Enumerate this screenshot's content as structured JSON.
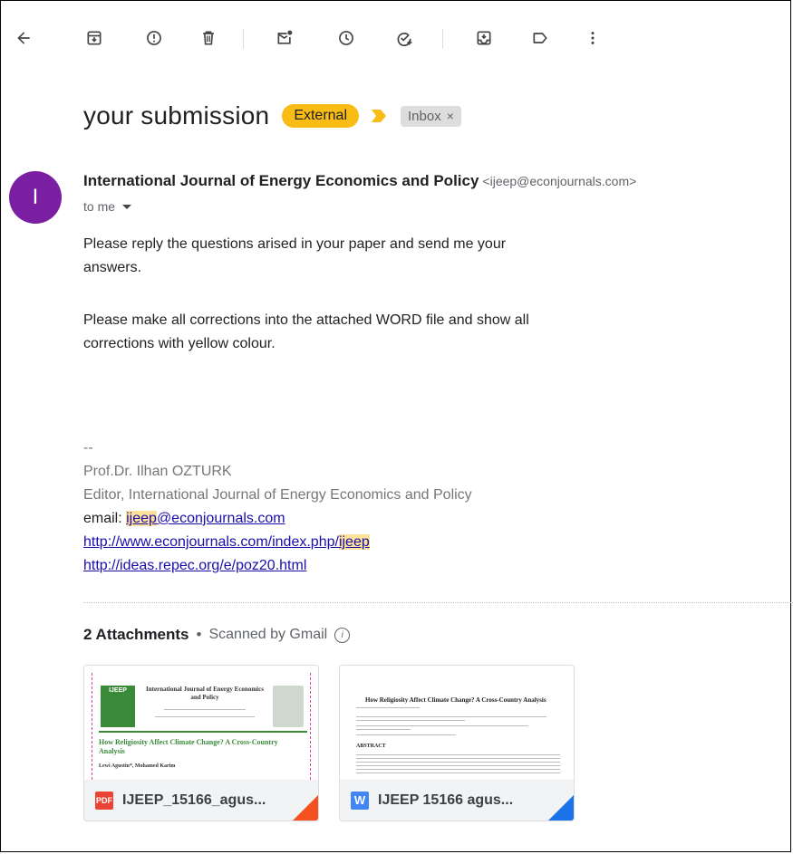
{
  "toolbar": {
    "icons": [
      "back-arrow-icon",
      "archive-icon",
      "report-spam-icon",
      "delete-icon",
      "mark-unread-icon",
      "snooze-icon",
      "add-task-icon",
      "move-to-icon",
      "label-icon",
      "more-vert-icon"
    ]
  },
  "subject": "your submission",
  "labels": {
    "external": "External",
    "inbox": "Inbox",
    "inbox_close": "×"
  },
  "sender": {
    "initial": "I",
    "name": "International Journal of Energy Economics and Policy",
    "email": "<ijeep@econjournals.com>",
    "to": "to me"
  },
  "body": {
    "p1_line1": "Please reply the questions arised in your paper and send me your",
    "p1_line2": "answers.",
    "p2_line1": "Please make all corrections into the attached WORD file and show all",
    "p2_line2": "corrections with yellow colour."
  },
  "signature": {
    "dashes": "--",
    "name": "Prof.Dr. Ilhan OZTURK",
    "role": "Editor, International Journal of Energy Economics and Policy",
    "email_label": "email: ",
    "email_hl": "ijeep",
    "email_rest": "@econjournals.com",
    "url1_main": "http://www.econjournals.com/index.php/",
    "url1_hl": "ijeep",
    "url2": "http://ideas.repec.org/e/poz20.html"
  },
  "attachments": {
    "count_label": "2 Attachments",
    "dot": "•",
    "scanned": "Scanned by Gmail",
    "info": "i",
    "items": [
      {
        "type_label": "PDF",
        "name": "IJEEP_15166_agus...",
        "color": "#f4511e",
        "preview_header": "International Journal of Energy Economics and Policy",
        "preview_title": "How Religiosity Affect Climate Change? A Cross-Country Analysis",
        "preview_logo": "IJEEP",
        "preview_authors": "Lewi Agustin*, Mohamed Karim"
      },
      {
        "type_label": "W",
        "name": "IJEEP 15166 agus...",
        "color": "#1a73e8",
        "preview_title": "How Religiosity Affect Climate Change? A Cross-Country Analysis",
        "preview_abstract": "ABSTRACT"
      }
    ]
  }
}
